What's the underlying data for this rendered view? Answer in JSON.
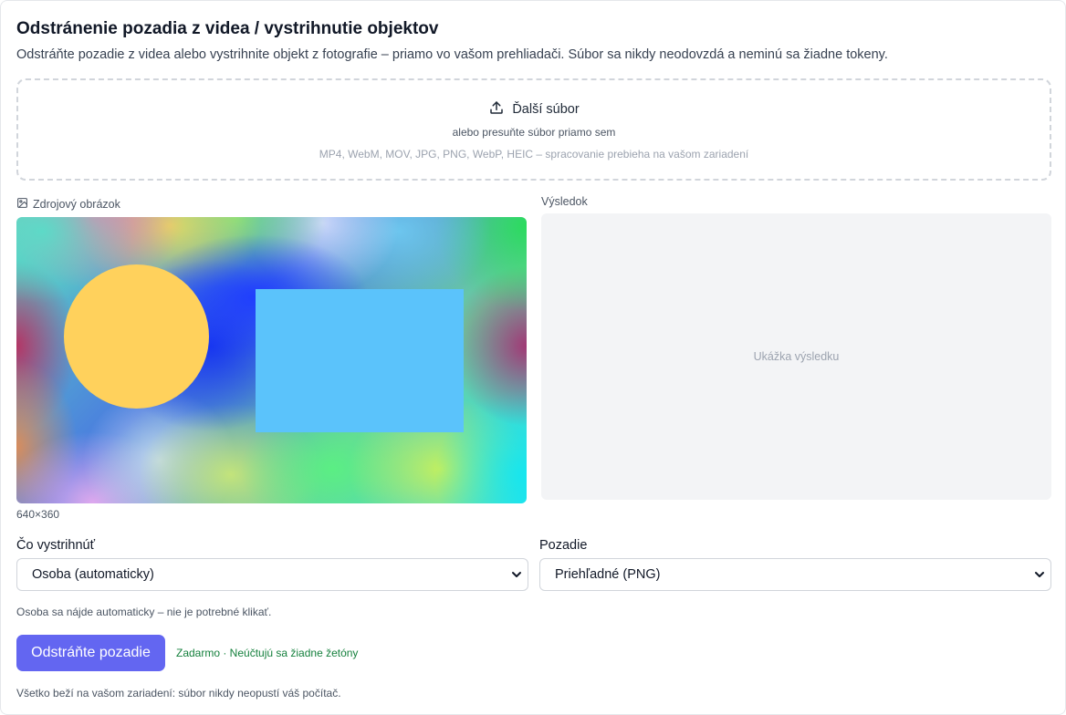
{
  "header": {
    "title": "Odstránenie pozadia z videa / vystrihnutie objektov",
    "subtitle": "Odstráňte pozadie z videa alebo vystrihnite objekt z fotografie – priamo vo vašom prehliadači. Súbor sa nikdy neodovzdá a neminú sa žiadne tokeny."
  },
  "dropzone": {
    "icon": "upload-icon",
    "label": "Ďalší súbor",
    "sub": "alebo presuňte súbor priamo sem",
    "formats": "MP4, WebM, MOV, JPG, PNG, WebP, HEIC – spracovanie prebieha na vašom zariadení"
  },
  "source": {
    "icon": "image-icon",
    "label": "Zdrojový obrázok",
    "dimensions": "640×360"
  },
  "result": {
    "label": "Výsledok",
    "placeholder": "Ukážka výsledku"
  },
  "options": {
    "cut_label": "Čo vystrihnúť",
    "cut_value": "Osoba (automaticky)",
    "bg_label": "Pozadie",
    "bg_value": "Priehľadné (PNG)",
    "hint": "Osoba sa nájde automaticky – nie je potrebné klikať."
  },
  "actions": {
    "remove_label": "Odstráňte pozadie",
    "free_note": "Zadarmo · Neúčtujú sa žiadne žetóny",
    "accent": "#6366f1"
  },
  "footer": {
    "note": "Všetko beží na vašom zariadení: súbor nikdy neopustí váš počítač."
  }
}
